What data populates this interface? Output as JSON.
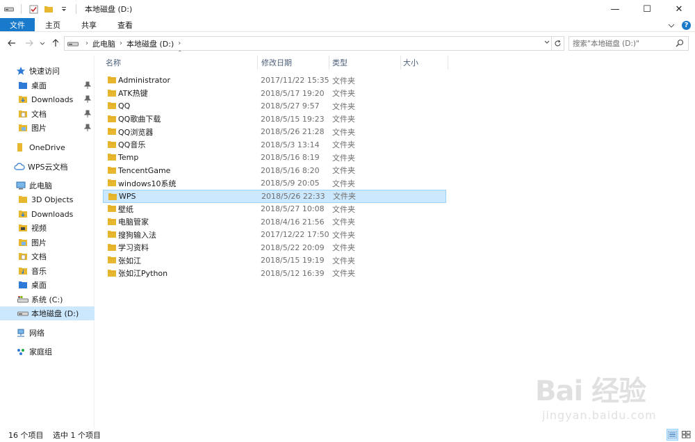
{
  "window": {
    "title": "本地磁盘 (D:)",
    "controls": {
      "minimize": "—",
      "maximize": "☐",
      "close": "✕"
    }
  },
  "ribbon": {
    "tabs": [
      {
        "label": "文件",
        "active": true
      },
      {
        "label": "主页"
      },
      {
        "label": "共享"
      },
      {
        "label": "查看"
      }
    ],
    "help": "?"
  },
  "address": {
    "crumbs": [
      "此电脑",
      "本地磁盘 (D:)"
    ],
    "search_placeholder": "搜索\"本地磁盘 (D:)\""
  },
  "sidebar": {
    "items": [
      {
        "label": "快速访问",
        "icon": "star-icon",
        "indent": 1,
        "pinned": false
      },
      {
        "label": "桌面",
        "icon": "folder-icon",
        "indent": 2,
        "pinned": true
      },
      {
        "label": "Downloads",
        "icon": "download-folder-icon",
        "indent": 2,
        "pinned": true
      },
      {
        "label": "文档",
        "icon": "document-folder-icon",
        "indent": 2,
        "pinned": true
      },
      {
        "label": "图片",
        "icon": "picture-folder-icon",
        "indent": 2,
        "pinned": true
      },
      {
        "label": "OneDrive",
        "icon": "folder-icon",
        "indent": 1,
        "pinned": false
      },
      {
        "label": "WPS云文档",
        "icon": "cloud-icon",
        "indent": 1,
        "pinned": false
      },
      {
        "label": "此电脑",
        "icon": "computer-icon",
        "indent": 1,
        "pinned": false
      },
      {
        "label": "3D Objects",
        "icon": "folder-icon",
        "indent": 2,
        "pinned": false
      },
      {
        "label": "Downloads",
        "icon": "download-folder-icon",
        "indent": 2,
        "pinned": false
      },
      {
        "label": "视频",
        "icon": "video-folder-icon",
        "indent": 2,
        "pinned": false
      },
      {
        "label": "图片",
        "icon": "picture-folder-icon",
        "indent": 2,
        "pinned": false
      },
      {
        "label": "文档",
        "icon": "document-folder-icon",
        "indent": 2,
        "pinned": false
      },
      {
        "label": "音乐",
        "icon": "music-folder-icon",
        "indent": 2,
        "pinned": false
      },
      {
        "label": "桌面",
        "icon": "folder-icon",
        "indent": 2,
        "pinned": false
      },
      {
        "label": "系统 (C:)",
        "icon": "system-drive-icon",
        "indent": 2,
        "pinned": false
      },
      {
        "label": "本地磁盘 (D:)",
        "icon": "drive-icon",
        "indent": 2,
        "pinned": false,
        "selected": true
      },
      {
        "label": "网络",
        "icon": "network-icon",
        "indent": 1,
        "pinned": false
      },
      {
        "label": "家庭组",
        "icon": "homegroup-icon",
        "indent": 1,
        "pinned": false
      }
    ]
  },
  "columns": {
    "name": "名称",
    "modified": "修改日期",
    "type": "类型",
    "size": "大小"
  },
  "files": [
    {
      "name": "Administrator",
      "modified": "2017/11/22 15:35",
      "type": "文件夹"
    },
    {
      "name": "ATK热键",
      "modified": "2018/5/17 19:20",
      "type": "文件夹"
    },
    {
      "name": "QQ",
      "modified": "2018/5/27 9:57",
      "type": "文件夹"
    },
    {
      "name": "QQ歌曲下载",
      "modified": "2018/5/15 19:23",
      "type": "文件夹"
    },
    {
      "name": "QQ浏览器",
      "modified": "2018/5/26 21:28",
      "type": "文件夹"
    },
    {
      "name": "QQ音乐",
      "modified": "2018/5/3 13:14",
      "type": "文件夹"
    },
    {
      "name": "Temp",
      "modified": "2018/5/16 8:19",
      "type": "文件夹"
    },
    {
      "name": "TencentGame",
      "modified": "2018/5/16 8:20",
      "type": "文件夹"
    },
    {
      "name": "windows10系统",
      "modified": "2018/5/9 20:05",
      "type": "文件夹"
    },
    {
      "name": "WPS",
      "modified": "2018/5/26 22:33",
      "type": "文件夹",
      "selected": true
    },
    {
      "name": "壁纸",
      "modified": "2018/5/27 10:08",
      "type": "文件夹"
    },
    {
      "name": "电脑管家",
      "modified": "2018/4/16 21:56",
      "type": "文件夹"
    },
    {
      "name": "搜狗输入法",
      "modified": "2017/12/22 17:50",
      "type": "文件夹"
    },
    {
      "name": "学习资料",
      "modified": "2018/5/22 20:09",
      "type": "文件夹"
    },
    {
      "name": "张如江",
      "modified": "2018/5/15 19:19",
      "type": "文件夹"
    },
    {
      "name": "张如江Python",
      "modified": "2018/5/12 16:39",
      "type": "文件夹"
    }
  ],
  "status": {
    "count": "16 个项目",
    "selection": "选中 1 个项目"
  },
  "watermark": {
    "line1": "Bai 经验",
    "line2": "jingyan.baidu.com"
  },
  "colors": {
    "accent": "#1979ca",
    "selection": "#cce8ff",
    "selection_border": "#99d1ff",
    "folder": "#e8b730"
  }
}
